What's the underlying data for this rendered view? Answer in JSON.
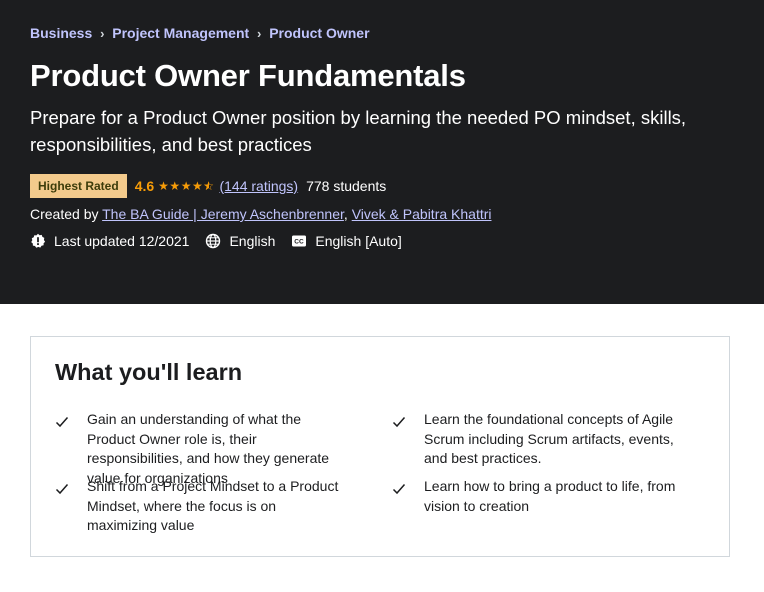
{
  "breadcrumb": [
    "Business",
    "Project Management",
    "Product Owner"
  ],
  "course": {
    "title": "Product Owner Fundamentals",
    "subtitle": "Prepare for a Product Owner position by learning the needed PO mindset, skills, responsibilities, and best practices",
    "badge": "Highest Rated",
    "rating": "4.6",
    "stars_value": 4.6,
    "ratings_text": "(144 ratings)",
    "students_text": "778 students",
    "created_by_label": "Created by",
    "authors": [
      "The BA Guide | Jeremy Aschenbrenner",
      "Vivek & Pabitra Khattri"
    ],
    "author_separator": ",",
    "last_updated": "Last updated 12/2021",
    "language": "English",
    "captions": "English [Auto]"
  },
  "icons": {
    "breadcrumb_separator": "chevron-right-icon",
    "rating": "star-icon",
    "last_updated": "alert-badge-icon",
    "language": "globe-icon",
    "captions": "closed-captions-icon",
    "learn_item": "checkmark-icon"
  },
  "learn": {
    "title": "What you'll learn",
    "items": [
      "Gain an understanding of what the Product Owner role is, their responsibilities, and how they generate value for organizations",
      "Learn the foundational concepts of Agile Scrum including Scrum artifacts, events, and best practices.",
      "Shift from a Project Mindset to a Product Mindset, where the focus is on maximizing value",
      "Learn how to bring a product to life, from vision to creation"
    ]
  },
  "colors": {
    "hero_bg": "#1c1d1f",
    "link": "#c0c4fc",
    "star": "#f69c08",
    "badge_bg": "#f3ca8c",
    "badge_text": "#3d3c0a",
    "border": "#d1d7dc"
  }
}
